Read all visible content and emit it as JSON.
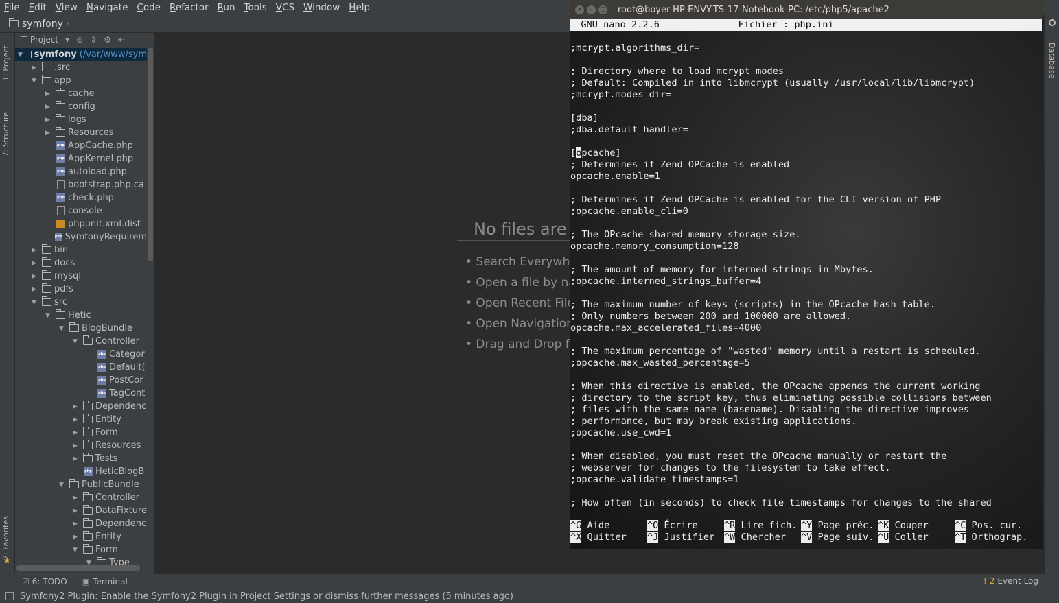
{
  "menu": [
    "File",
    "Edit",
    "View",
    "Navigate",
    "Code",
    "Refactor",
    "Run",
    "Tools",
    "VCS",
    "Window",
    "Help"
  ],
  "breadcrumb": {
    "project": "symfony"
  },
  "left_tabs": [
    "1: Project",
    "7: Structure",
    "2: Favorites"
  ],
  "right_tabs": [
    "Database"
  ],
  "project_panel": {
    "header": "Project",
    "tree": [
      {
        "name": "symfony",
        "path": "(/var/www/sym",
        "depth": 0,
        "type": "folder",
        "open": true,
        "root": true
      },
      {
        "name": ".src",
        "depth": 1,
        "type": "folder",
        "open": false
      },
      {
        "name": "app",
        "depth": 1,
        "type": "folder",
        "open": true
      },
      {
        "name": "cache",
        "depth": 2,
        "type": "folder",
        "open": false
      },
      {
        "name": "config",
        "depth": 2,
        "type": "folder",
        "open": false
      },
      {
        "name": "logs",
        "depth": 2,
        "type": "folder",
        "open": false
      },
      {
        "name": "Resources",
        "depth": 2,
        "type": "folder",
        "open": false
      },
      {
        "name": "AppCache.php",
        "depth": 2,
        "type": "php"
      },
      {
        "name": "AppKernel.php",
        "depth": 2,
        "type": "php"
      },
      {
        "name": "autoload.php",
        "depth": 2,
        "type": "php"
      },
      {
        "name": "bootstrap.php.ca",
        "depth": 2,
        "type": "file"
      },
      {
        "name": "check.php",
        "depth": 2,
        "type": "php"
      },
      {
        "name": "console",
        "depth": 2,
        "type": "file"
      },
      {
        "name": "phpunit.xml.dist",
        "depth": 2,
        "type": "xml"
      },
      {
        "name": "SymfonyRequirem",
        "depth": 2,
        "type": "php"
      },
      {
        "name": "bin",
        "depth": 1,
        "type": "folder",
        "open": false
      },
      {
        "name": "docs",
        "depth": 1,
        "type": "folder",
        "open": false
      },
      {
        "name": "mysql",
        "depth": 1,
        "type": "folder",
        "open": false
      },
      {
        "name": "pdfs",
        "depth": 1,
        "type": "folder",
        "open": false
      },
      {
        "name": "src",
        "depth": 1,
        "type": "folder",
        "open": true
      },
      {
        "name": "Hetic",
        "depth": 2,
        "type": "folder",
        "open": true
      },
      {
        "name": "BlogBundle",
        "depth": 3,
        "type": "folder",
        "open": true
      },
      {
        "name": "Controller",
        "depth": 4,
        "type": "folder",
        "open": true
      },
      {
        "name": "Categor",
        "depth": 5,
        "type": "php"
      },
      {
        "name": "Default(",
        "depth": 5,
        "type": "php"
      },
      {
        "name": "PostCor",
        "depth": 5,
        "type": "php"
      },
      {
        "name": "TagCont",
        "depth": 5,
        "type": "php"
      },
      {
        "name": "Dependenc",
        "depth": 4,
        "type": "folder",
        "open": false
      },
      {
        "name": "Entity",
        "depth": 4,
        "type": "folder",
        "open": false
      },
      {
        "name": "Form",
        "depth": 4,
        "type": "folder",
        "open": false
      },
      {
        "name": "Resources",
        "depth": 4,
        "type": "folder",
        "open": false
      },
      {
        "name": "Tests",
        "depth": 4,
        "type": "folder",
        "open": false
      },
      {
        "name": "HeticBlogB",
        "depth": 4,
        "type": "php"
      },
      {
        "name": "PublicBundle",
        "depth": 3,
        "type": "folder",
        "open": true
      },
      {
        "name": "Controller",
        "depth": 4,
        "type": "folder",
        "open": false
      },
      {
        "name": "DataFixture",
        "depth": 4,
        "type": "folder",
        "open": false
      },
      {
        "name": "Dependenc",
        "depth": 4,
        "type": "folder",
        "open": false
      },
      {
        "name": "Entity",
        "depth": 4,
        "type": "folder",
        "open": false
      },
      {
        "name": "Form",
        "depth": 4,
        "type": "folder",
        "open": true
      },
      {
        "name": "Type",
        "depth": 5,
        "type": "folder",
        "open": true
      }
    ]
  },
  "editor": {
    "no_files": "No files are",
    "hints": [
      "• Search Everywhe",
      "• Open a file by na",
      "• Open Recent File",
      "• Open Navigation",
      "• Drag and Drop fi"
    ]
  },
  "terminal": {
    "title": "root@boyer-HP-ENVY-TS-17-Notebook-PC: /etc/php5/apache2",
    "nano_header": "  GNU nano 2.2.6              Fichier : php.ini",
    "lines": [
      ";mcrypt.algorithms_dir=",
      "",
      "; Directory where to load mcrypt modes",
      "; Default: Compiled in into libmcrypt (usually /usr/local/lib/libmcrypt)",
      ";mcrypt.modes_dir=",
      "",
      "[dba]",
      ";dba.default_handler=",
      "",
      "[opcache]",
      "; Determines if Zend OPCache is enabled",
      "opcache.enable=1",
      "",
      "; Determines if Zend OPCache is enabled for the CLI version of PHP",
      ";opcache.enable_cli=0",
      "",
      "; The OPcache shared memory storage size.",
      "opcache.memory_consumption=128",
      "",
      "; The amount of memory for interned strings in Mbytes.",
      ";opcache.interned_strings_buffer=4",
      "",
      "; The maximum number of keys (scripts) in the OPcache hash table.",
      "; Only numbers between 200 and 100000 are allowed.",
      "opcache.max_accelerated_files=4000",
      "",
      "; The maximum percentage of \"wasted\" memory until a restart is scheduled.",
      ";opcache.max_wasted_percentage=5",
      "",
      "; When this directive is enabled, the OPcache appends the current working",
      "; directory to the script key, thus eliminating possible collisions between",
      "; files with the same name (basename). Disabling the directive improves",
      "; performance, but may break existing applications.",
      ";opcache.use_cwd=1",
      "",
      "; When disabled, you must reset the OPcache manually or restart the",
      "; webserver for changes to the filesystem to take effect.",
      ";opcache.validate_timestamps=1",
      "",
      "; How often (in seconds) to check file timestamps for changes to the shared"
    ],
    "shortcuts": [
      [
        {
          "key": "^G",
          "label": "Aide"
        },
        {
          "key": "^O",
          "label": "Écrire"
        },
        {
          "key": "^R",
          "label": "Lire fich."
        },
        {
          "key": "^Y",
          "label": "Page préc."
        },
        {
          "key": "^K",
          "label": "Couper"
        },
        {
          "key": "^C",
          "label": "Pos. cur."
        }
      ],
      [
        {
          "key": "^X",
          "label": "Quitter"
        },
        {
          "key": "^J",
          "label": "Justifier"
        },
        {
          "key": "^W",
          "label": "Chercher"
        },
        {
          "key": "^V",
          "label": "Page suiv."
        },
        {
          "key": "^U",
          "label": "Coller"
        },
        {
          "key": "^T",
          "label": "Orthograp."
        }
      ]
    ]
  },
  "bottom_tabs": {
    "todo": "6: TODO",
    "terminal": "Terminal",
    "event_log": "Event Log",
    "event_count": "2"
  },
  "status": "Symfony2 Plugin: Enable the Symfony2 Plugin in Project Settings or dismiss further messages (5 minutes ago)"
}
